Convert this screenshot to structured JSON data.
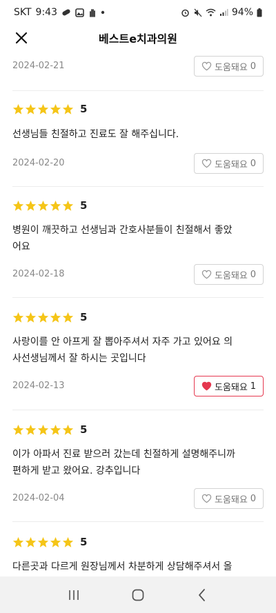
{
  "status_bar": {
    "carrier": "SKT",
    "time": "9:43",
    "battery": "94%"
  },
  "header": {
    "title": "베스트e치과의원"
  },
  "helpful_label": "도움돼요",
  "colors": {
    "star": "#f5c518",
    "accent": "#e5384f",
    "divider": "#ececec"
  },
  "reviews": [
    {
      "date": "2024-02-21",
      "helpful_count": "0",
      "helpful_active": false
    },
    {
      "rating": "5",
      "text": "선생님들 친절하고 진료도 잘 해주십니다.",
      "date": "2024-02-20",
      "helpful_count": "0",
      "helpful_active": false
    },
    {
      "rating": "5",
      "text_line1": "병원이 깨끗하고 선생님과 간호사분들이 친절해서 좋았",
      "text_line2": "어요",
      "date": "2024-02-18",
      "helpful_count": "0",
      "helpful_active": false
    },
    {
      "rating": "5",
      "text_line1": "사랑이를 안 아프게 잘 뽑아주셔서 자주 가고 있어요 의",
      "text_line2": "사선생님께서 잘 하시는 곳입니다",
      "date": "2024-02-13",
      "helpful_count": "1",
      "helpful_active": true
    },
    {
      "rating": "5",
      "text_line1": "이가 아파서 진료 받으러 갔는데 친절하게 설명해주니까",
      "text_line2": "편하게 받고 왔어요. 강추입니다",
      "date": "2024-02-04",
      "helpful_count": "0",
      "helpful_active": false
    },
    {
      "rating": "5",
      "text_line1": "다른곳과 다르게 원장님께서 차분하게 상담해주셔서 올"
    }
  ]
}
